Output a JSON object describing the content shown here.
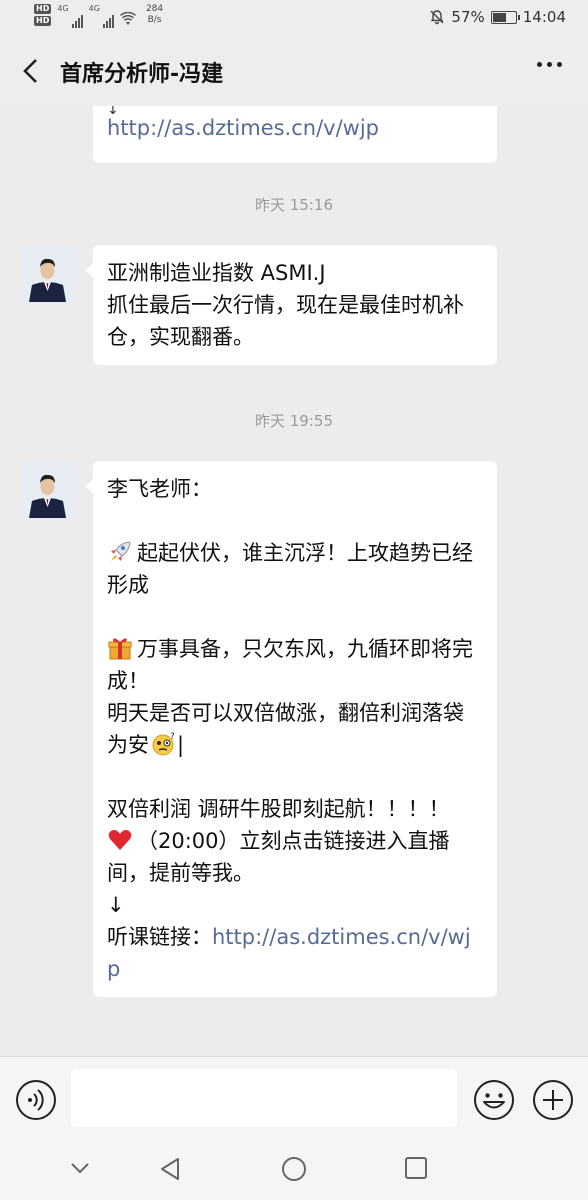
{
  "status_bar": {
    "hd1": "HD",
    "hd2": "HD",
    "net1": "4G",
    "net2": "4G",
    "speed_value": "284",
    "speed_unit": "B/s",
    "battery_percent": "57%",
    "battery_level": 0.57,
    "time": "14:04"
  },
  "header": {
    "title": "首席分析师-冯建"
  },
  "messages": {
    "m0_link": "http://as.dztimes.cn/v/wjp",
    "m0_arrow": "↓",
    "ts1": "昨天 15:16",
    "m1": {
      "l1": "亚洲制造业指数 ASMI.J",
      "l2": "抓住最后一次行情，现在是最佳时机补仓，实现翻番。"
    },
    "ts2": "昨天 19:55",
    "m2": {
      "l1": "李飞老师：",
      "l2": "起起伏伏，谁主沉浮！上攻趋势已经形成",
      "l3": "万事具备，只欠东风，九循环即将完成！",
      "l4": "明天是否可以双倍做涨，翻倍利润落袋为安",
      "l4_tail": "|",
      "l5": "双倍利润 调研牛股即刻起航！！！！",
      "l6": "（20:00）立刻点击链接进入直播间，提前等我。",
      "l7": "↓",
      "l8_prefix": "听课链接：",
      "l8_link": "http://as.dztimes.cn/v/wjp"
    }
  },
  "icons": {
    "back": "back-arrow-icon",
    "more": "more-icon",
    "voice": "voice-icon",
    "emoji": "emoji-icon",
    "plus": "plus-icon",
    "rocket": "rocket-icon",
    "gift": "gift-icon",
    "thinking": "thinking-face-icon",
    "heart": "heart-icon"
  },
  "colors": {
    "link": "#576b95",
    "background": "#ececec",
    "bubble": "#ffffff",
    "timestamp": "#9a9a9a"
  }
}
